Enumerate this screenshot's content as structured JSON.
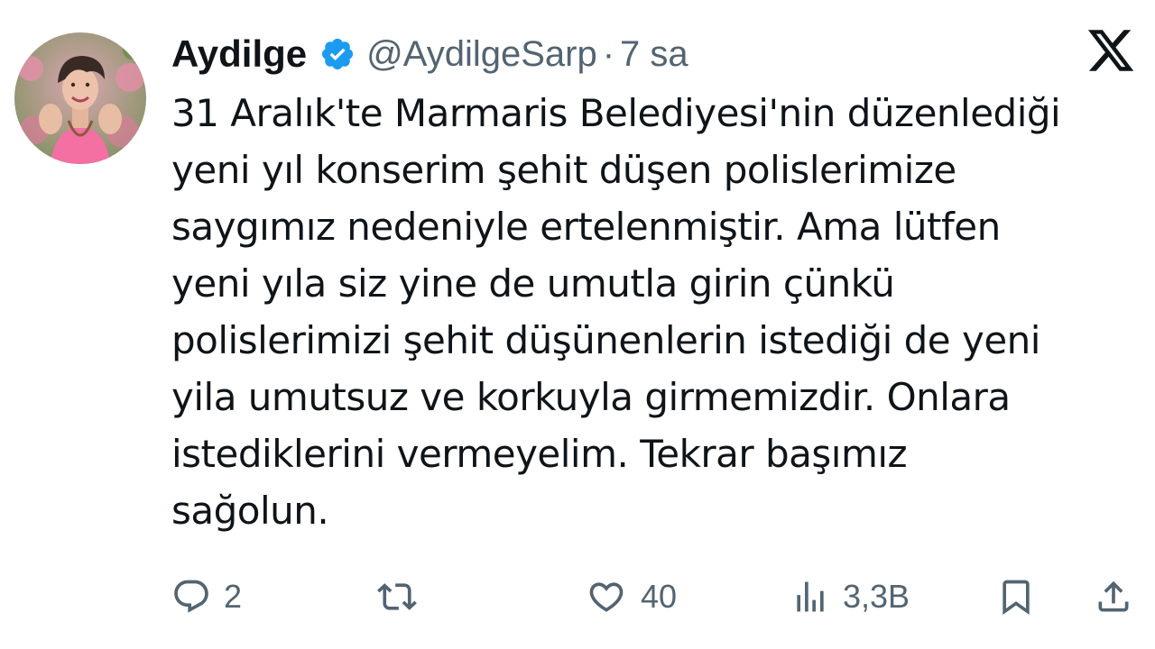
{
  "author": {
    "display_name": "Aydilge",
    "handle": "@AydilgeSarp",
    "separator": "·",
    "time": "7 sa",
    "verified": true,
    "avatar_icon": "profile-photo"
  },
  "logo_icon": "x-logo-icon",
  "tweet": {
    "lines": [
      "31 Aralık'te Marmaris  Belediyesi'nin düzenlediği",
      "yeni yıl konserim şehit düşen polislerimize",
      "saygımız nedeniyle ertelenmiştir. Ama lütfen",
      "yeni yıla siz yine de umutla girin çünkü",
      "polislerimizi şehit düşünenlerin istediği de yeni",
      "yila umutsuz ve korkuyla girmemizdir. Onlara",
      "istediklerini vermeyelim. Tekrar başımız",
      "sağolun."
    ]
  },
  "actions": {
    "reply": {
      "icon": "reply-icon",
      "count": "2"
    },
    "retweet": {
      "icon": "retweet-icon",
      "count": ""
    },
    "like": {
      "icon": "heart-icon",
      "count": "40"
    },
    "views": {
      "icon": "views-icon",
      "count": "3,3B"
    },
    "bookmark": {
      "icon": "bookmark-icon"
    },
    "share": {
      "icon": "share-icon"
    }
  },
  "colors": {
    "text": "#0f1419",
    "secondary": "#536471",
    "verified": "#1d9bf0"
  }
}
